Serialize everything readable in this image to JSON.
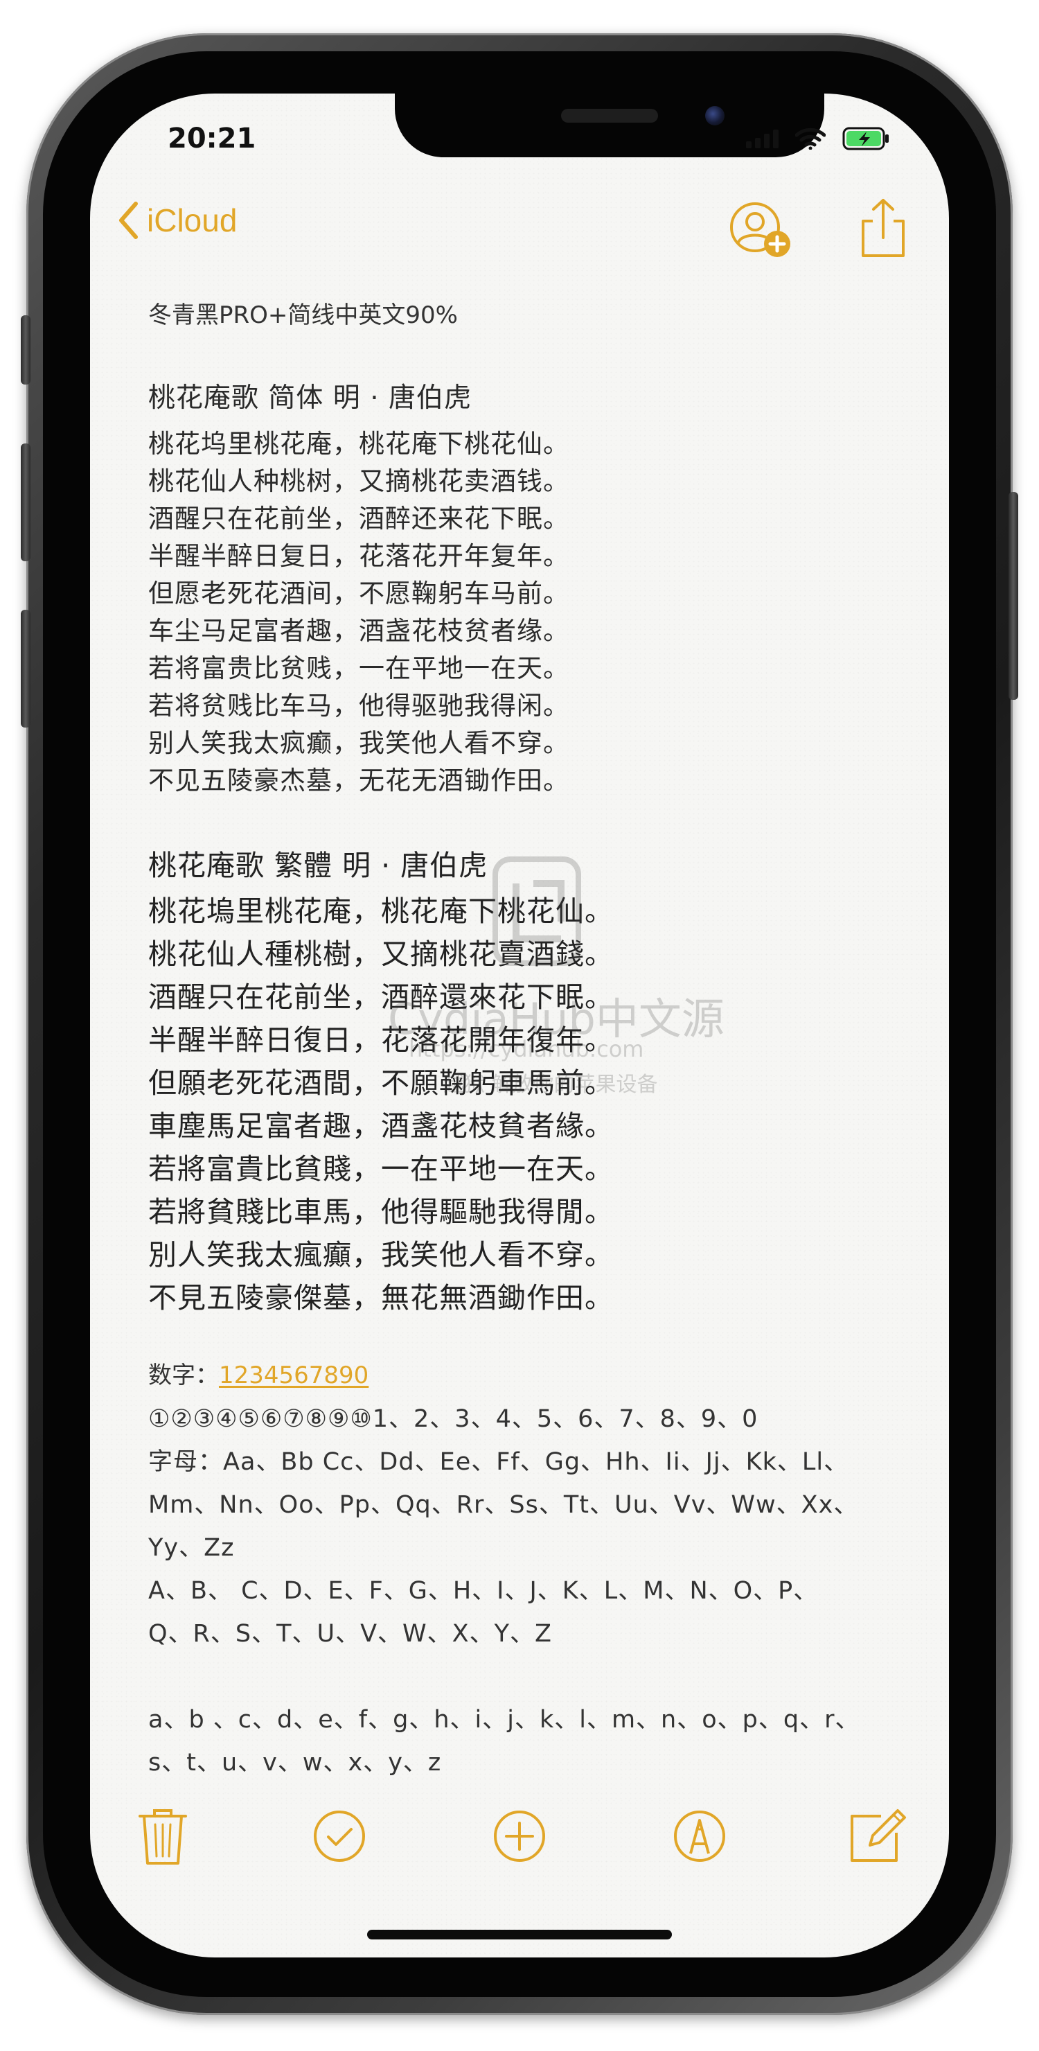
{
  "status_bar": {
    "time": "20:21"
  },
  "nav": {
    "back_label": "iCloud"
  },
  "colors": {
    "accent": "#e1a628",
    "battery": "#4cd964"
  },
  "icons": {
    "back": "chevron-left-icon",
    "add_person": "person-add-icon",
    "share": "share-icon",
    "trash": "trash-icon",
    "checklist": "checkmark-circle-icon",
    "add": "plus-circle-icon",
    "markup": "pen-circle-icon",
    "compose": "compose-icon"
  },
  "note": {
    "heading": "冬青黑PRO+简线中英文90%",
    "poem_simplified": {
      "title": "桃花庵歌   简体    明  ·  唐伯虎",
      "lines": [
        "桃花坞里桃花庵，桃花庵下桃花仙。",
        "桃花仙人种桃树，又摘桃花卖酒钱。",
        "酒醒只在花前坐，酒醉还来花下眠。",
        "半醒半醉日复日，花落花开年复年。",
        "但愿老死花酒间，不愿鞠躬车马前。",
        "车尘马足富者趣，酒盏花枝贫者缘。",
        "若将富贵比贫贱，一在平地一在天。",
        "若将贫贱比车马，他得驱驰我得闲。",
        "别人笑我太疯癫，我笑他人看不穿。",
        "不见五陵豪杰墓，无花无酒锄作田。"
      ]
    },
    "poem_traditional": {
      "title": "桃花庵歌   繁體        明  ·  唐伯虎",
      "lines": [
        "桃花塢里桃花庵，桃花庵下桃花仙。",
        "桃花仙人種桃樹，又摘桃花賣酒錢。",
        "酒醒只在花前坐，酒醉還來花下眠。",
        "半醒半醉日復日，花落花開年復年。",
        "但願老死花酒間，不願鞠躬車馬前。",
        "車塵馬足富者趣，酒盞花枝貧者緣。",
        "若將富貴比貧賤，一在平地一在天。",
        "若將貧賤比車馬，他得驅馳我得閒。",
        "別人笑我太瘋癲，我笑他人看不穿。",
        "不見五陵豪傑墓，無花無酒鋤作田。"
      ]
    },
    "digits_label": "数字：",
    "digits_link": "1234567890",
    "circled_digits": "①②③④⑤⑥⑦⑧⑨⑩1、2、3、4、5、6、7、8、9、0",
    "letters_lines": [
      "字母：Aa、Bb Cc、Dd、Ee、Ff、Gg、Hh、Ii、Jj、Kk、Ll、",
      "Mm、Nn、Oo、Pp、Qq、Rr、Ss、Tt、Uu、Vv、Ww、Xx、",
      "Yy、Zz"
    ],
    "upper_lines": [
      "A、B、 C、D、E、F、G、H、I、J、K、L、M、N、O、P、",
      "Q、R、S、T、U、V、W、X、Y、Z"
    ],
    "lower_lines": [
      "a、b 、c、d、e、f、g、h、i、j、k、l、m、n、o、p、q、r、",
      "s、t、u、v、w、x、y、z"
    ]
  },
  "watermark": {
    "title": "CydiaHub中文源",
    "url": "https://cydiahub.com",
    "slogan": "越狱 解放你的苹果设备"
  }
}
